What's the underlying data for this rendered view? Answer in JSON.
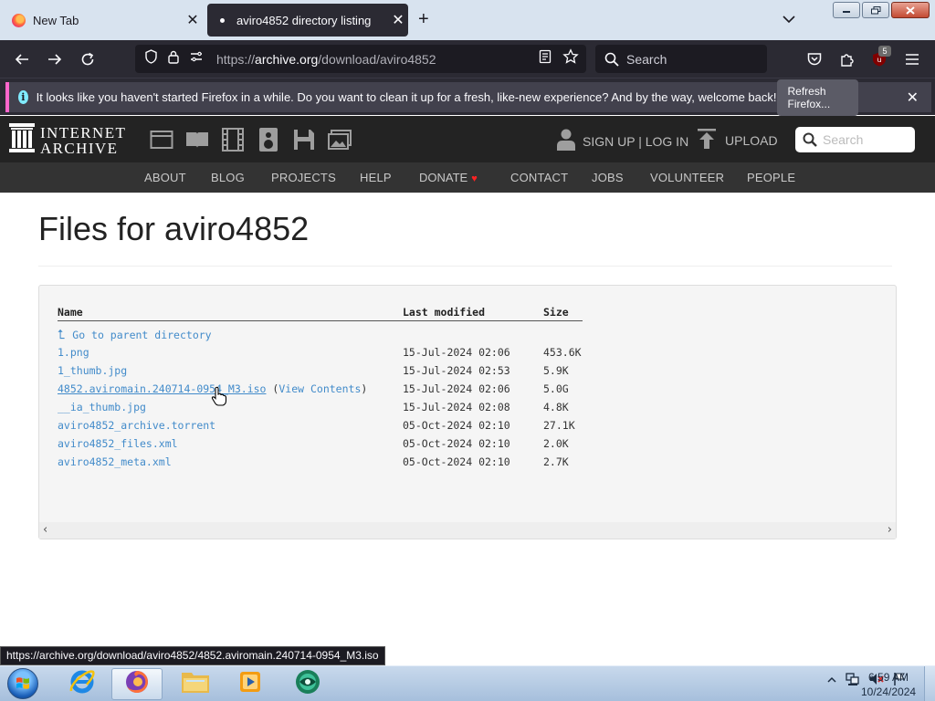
{
  "browser": {
    "tabs": [
      {
        "title": "New Tab",
        "close": "✕",
        "active": false
      },
      {
        "title": "aviro4852 directory listing",
        "close": "✕",
        "active": true
      }
    ],
    "new_tab": "+",
    "url_prefix": "https://",
    "url_host": "archive.org",
    "url_path": "/download/aviro4852",
    "search_placeholder": "Search",
    "extension_badge": "5"
  },
  "notification": {
    "info": "i",
    "message": "It looks like you haven't started Firefox in a while. Do you want to clean it up for a fresh, like-new experience? And by the way, welcome back!",
    "button": "Refresh Firefox...",
    "close": "✕"
  },
  "ia": {
    "logo_line1": "INTERNET",
    "logo_line2": "ARCHIVE",
    "account": "SIGN UP | LOG IN",
    "upload": "UPLOAD",
    "search_placeholder": "Search",
    "nav": [
      "ABOUT",
      "BLOG",
      "PROJECTS",
      "HELP",
      "DONATE",
      "CONTACT",
      "JOBS",
      "VOLUNTEER",
      "PEOPLE"
    ]
  },
  "page": {
    "title": "Files for aviro4852",
    "headers": {
      "name": "Name",
      "modified": "Last modified",
      "size": "Size"
    },
    "parent": "Go to parent directory",
    "files": [
      {
        "name": "1.png",
        "modified": "15-Jul-2024 02:06",
        "size": "453.6K"
      },
      {
        "name": "1_thumb.jpg",
        "modified": "15-Jul-2024 02:53",
        "size": "5.9K"
      },
      {
        "name": "4852.aviromain.240714-0954_M3.iso",
        "view": "View Contents",
        "modified": "15-Jul-2024 02:06",
        "size": "5.0G"
      },
      {
        "name": "__ia_thumb.jpg",
        "modified": "15-Jul-2024 02:08",
        "size": "4.8K"
      },
      {
        "name": "aviro4852_archive.torrent",
        "modified": "05-Oct-2024 02:10",
        "size": "27.1K"
      },
      {
        "name": "aviro4852_files.xml",
        "modified": "05-Oct-2024 02:10",
        "size": "2.0K"
      },
      {
        "name": "aviro4852_meta.xml",
        "modified": "05-Oct-2024 02:10",
        "size": "2.7K"
      }
    ]
  },
  "status_url": "https://archive.org/download/aviro4852/4852.aviromain.240714-0954_M3.iso",
  "taskbar": {
    "time": "6:59 AM",
    "date": "10/24/2024"
  },
  "colors": {
    "link": "#428bca",
    "ia_header": "#232323",
    "ia_nav": "#333333",
    "browser_dark": "#2b2a33",
    "notif_accent": "#ff66cc"
  }
}
